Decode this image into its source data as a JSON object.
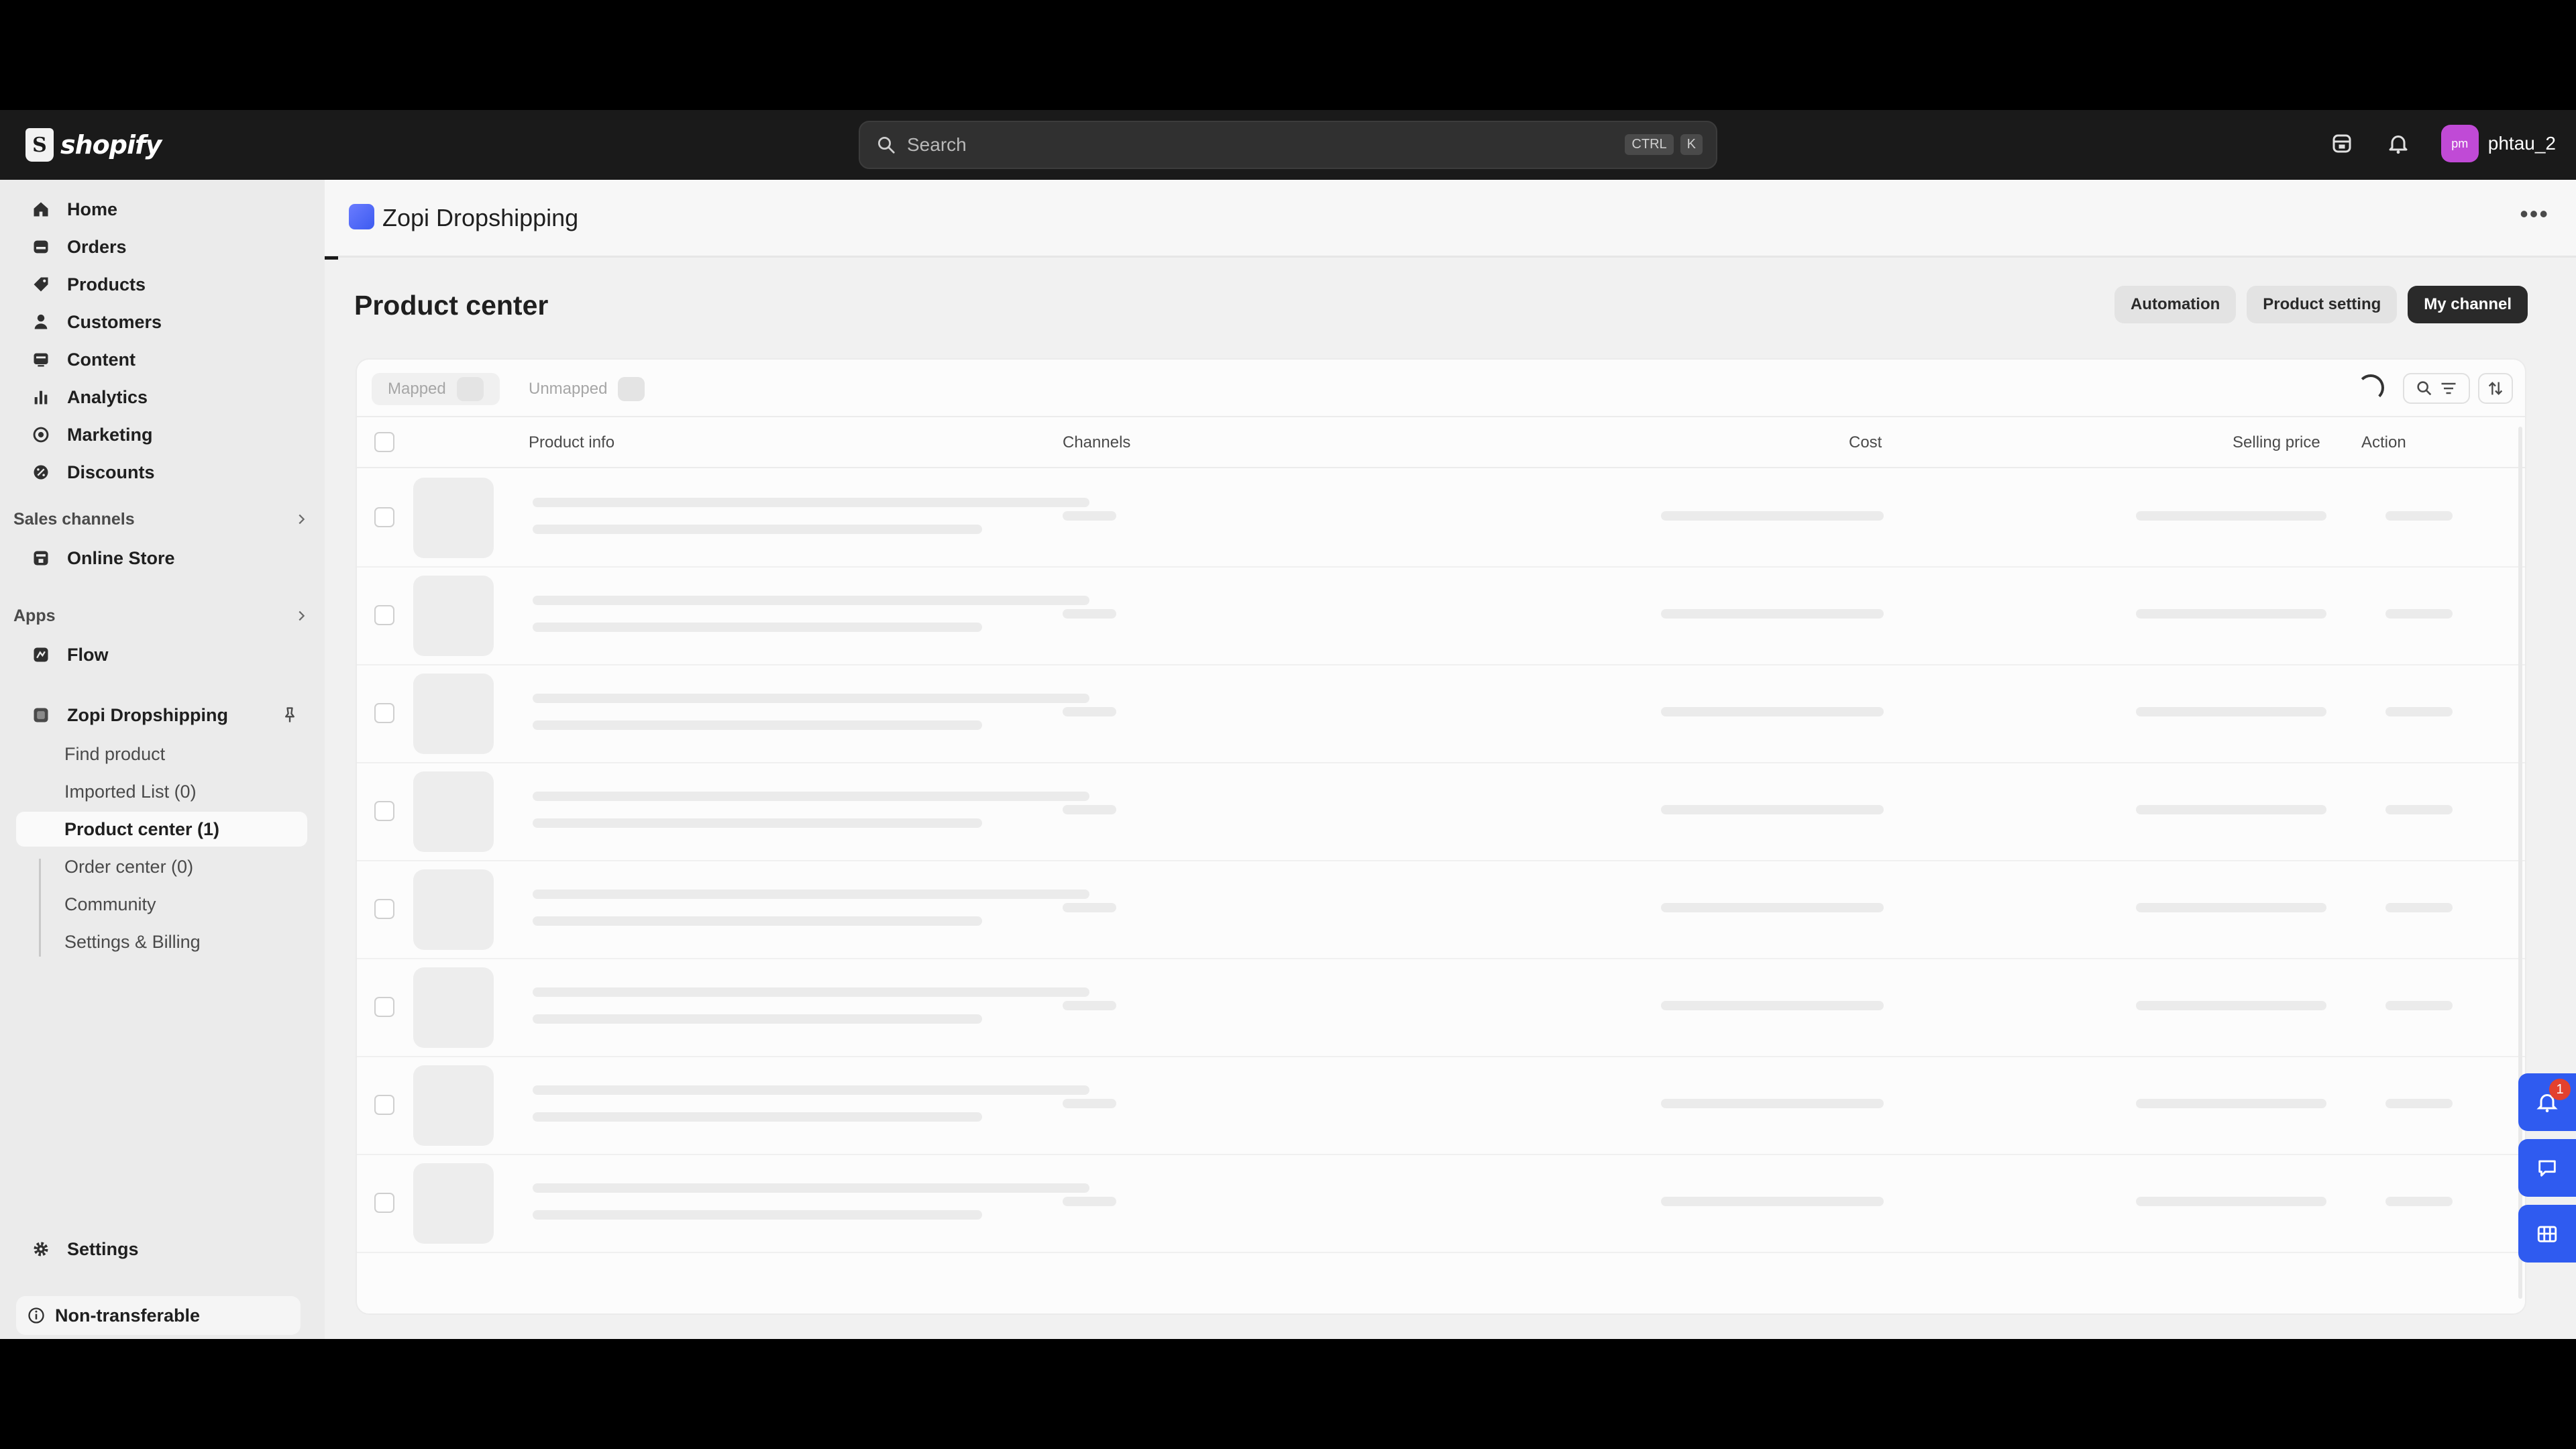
{
  "topbar": {
    "logo_text": "shopify",
    "search_placeholder": "Search",
    "shortcut_keys": [
      "CTRL",
      "K"
    ],
    "avatar_initials": "pm",
    "account_name": "phtau_2"
  },
  "sidebar": {
    "main_items": [
      {
        "label": "Home",
        "icon": "home-icon"
      },
      {
        "label": "Orders",
        "icon": "orders-icon"
      },
      {
        "label": "Products",
        "icon": "tag-icon"
      },
      {
        "label": "Customers",
        "icon": "person-icon"
      },
      {
        "label": "Content",
        "icon": "content-icon"
      },
      {
        "label": "Analytics",
        "icon": "bar-chart-icon"
      },
      {
        "label": "Marketing",
        "icon": "target-icon"
      },
      {
        "label": "Discounts",
        "icon": "discount-icon"
      }
    ],
    "sales_channels_label": "Sales channels",
    "online_store_label": "Online Store",
    "apps_label": "Apps",
    "flow_label": "Flow",
    "app_name": "Zopi Dropshipping",
    "app_sub_items": [
      "Find product",
      "Imported List (0)",
      "Product center (1)",
      "Order center (0)",
      "Community",
      "Settings & Billing"
    ],
    "settings_label": "Settings",
    "non_transferable_label": "Non-transferable"
  },
  "app_header": {
    "title": "Zopi Dropshipping"
  },
  "page": {
    "title": "Product center",
    "buttons": [
      "Automation",
      "Product setting",
      "My channel"
    ]
  },
  "table": {
    "tabs": [
      "Mapped",
      "Unmapped"
    ],
    "columns": [
      "Product info",
      "Channels",
      "Cost",
      "Selling price",
      "Action"
    ]
  },
  "floating": {
    "notification_count": "1"
  },
  "colors": {
    "accent_blue": "#2f5bf0",
    "topbar_bg": "#1a1a1a",
    "badge_red": "#e3412e"
  }
}
